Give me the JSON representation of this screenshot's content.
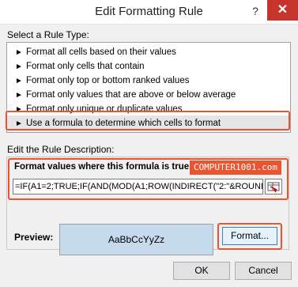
{
  "dialog": {
    "title": "Edit Formatting Rule",
    "help_glyph": "?",
    "close_glyph": "✕"
  },
  "rule_type": {
    "label": "Select a Rule Type:",
    "items": [
      {
        "label": "Format all cells based on their values"
      },
      {
        "label": "Format only cells that contain"
      },
      {
        "label": "Format only top or bottom ranked values"
      },
      {
        "label": "Format only values that are above or below average"
      },
      {
        "label": "Format only unique or duplicate values"
      },
      {
        "label": "Use a formula to determine which cells to format",
        "selected": true
      }
    ]
  },
  "description": {
    "label": "Edit the Rule Description:",
    "formula_label": "Format values where this formula is true:",
    "formula_value": "=IF(A1=2;TRUE;IF(AND(MOD(A1;ROW(INDIRECT(\"2:\"&ROUND",
    "watermark": "COMPUTER1001.com"
  },
  "preview": {
    "label": "Preview:",
    "sample_text": "AaBbCcYyZz",
    "format_button": "Format..."
  },
  "footer": {
    "ok_label": "OK",
    "cancel_label": "Cancel"
  },
  "colors": {
    "highlight": "#e8552f",
    "preview_fill": "#c5daec",
    "close_button": "#c7342b"
  }
}
